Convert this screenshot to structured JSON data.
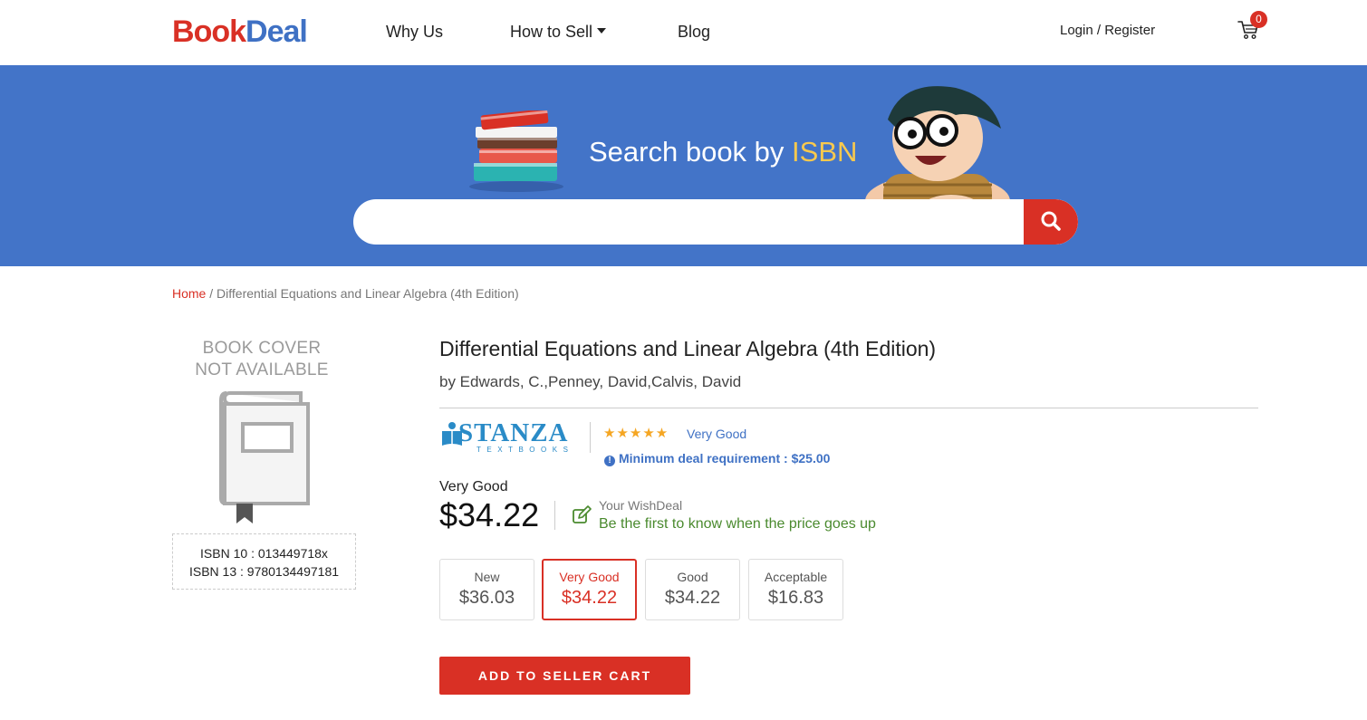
{
  "header": {
    "logo": {
      "b": "B",
      "ook": "ook",
      "deal": "Deal"
    },
    "nav": {
      "why_us": "Why Us",
      "how_to_sell": "How to Sell",
      "blog": "Blog"
    },
    "login": "Login / Register",
    "cart_count": "0"
  },
  "banner": {
    "title_prefix": "Search book by ",
    "title_highlight": "ISBN",
    "search_placeholder": ""
  },
  "breadcrumb": {
    "home": "Home",
    "separator": " / ",
    "current": "Differential Equations and Linear Algebra (4th Edition)"
  },
  "cover": {
    "line1": "BOOK COVER",
    "line2": "NOT AVAILABLE",
    "isbn10": "ISBN 10 : 013449718x",
    "isbn13": "ISBN 13 : 9780134497181"
  },
  "product": {
    "title": "Differential Equations and Linear Algebra (4th Edition)",
    "author": "by Edwards, C.,Penney, David,Calvis, David",
    "seller": {
      "name": "STANZA",
      "sub": "TEXTBOOKS"
    },
    "rating_stars": "★★★★★",
    "rating_value": 4.5,
    "rating_label": "Very Good",
    "min_deal": "Minimum deal requirement : $25.00",
    "condition_label": "Very Good",
    "price": "$34.22",
    "wish_label": "Your WishDeal",
    "wish_text": "Be the first to know when the price goes up",
    "conditions": [
      {
        "name": "New",
        "price": "$36.03"
      },
      {
        "name": "Very Good",
        "price": "$34.22",
        "selected": true
      },
      {
        "name": "Good",
        "price": "$34.22"
      },
      {
        "name": "Acceptable",
        "price": "$16.83"
      }
    ],
    "add_button": "ADD TO SELLER CART"
  },
  "colors": {
    "brand_red": "#d93025",
    "brand_blue": "#4374c8",
    "highlight_yellow": "#f8c94e",
    "star": "#f5a623",
    "wish_green": "#4a8a2e"
  }
}
